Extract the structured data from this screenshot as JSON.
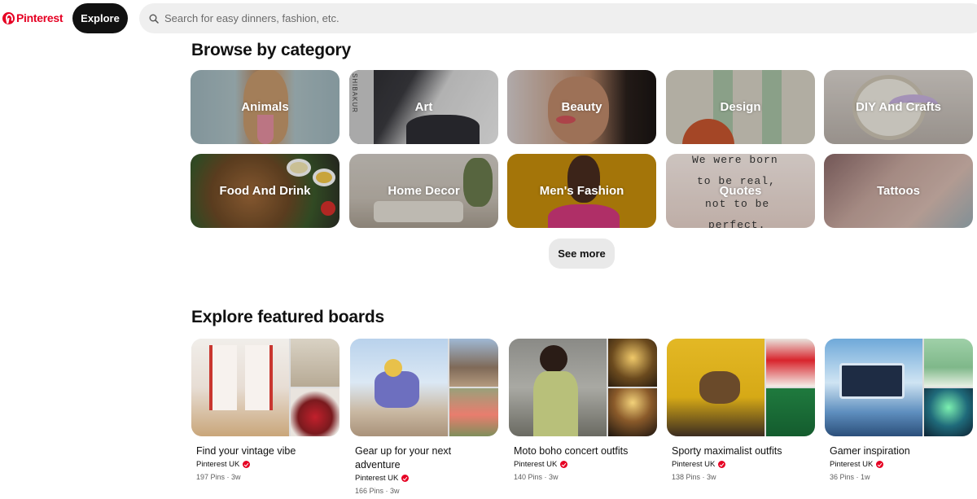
{
  "header": {
    "logo_text": "Pinterest",
    "explore_label": "Explore",
    "search_placeholder": "Search for easy dinners, fashion, etc.",
    "search_value": ""
  },
  "browse": {
    "title": "Browse by category",
    "categories": [
      {
        "label": "Animals"
      },
      {
        "label": "Art"
      },
      {
        "label": "Beauty"
      },
      {
        "label": "Design"
      },
      {
        "label": "DIY And Crafts"
      },
      {
        "label": "Food And Drink"
      },
      {
        "label": "Home Decor"
      },
      {
        "label": "Men's Fashion"
      },
      {
        "label": "Quotes"
      },
      {
        "label": "Tattoos"
      }
    ],
    "see_more_label": "See more",
    "quotes_image_text": [
      "We were born",
      "to be real,",
      "not to be",
      "perfect."
    ],
    "art_image_text": "SHIBAKUR"
  },
  "featured": {
    "title": "Explore featured boards",
    "boards": [
      {
        "title": "Find your vintage vibe",
        "owner": "Pinterest UK",
        "meta": "197 Pins · 3w"
      },
      {
        "title": "Gear up for your next adventure",
        "owner": "Pinterest UK",
        "meta": "166 Pins · 3w"
      },
      {
        "title": "Moto boho concert outfits",
        "owner": "Pinterest UK",
        "meta": "140 Pins · 3w"
      },
      {
        "title": "Sporty maximalist outfits",
        "owner": "Pinterest UK",
        "meta": "138 Pins · 3w"
      },
      {
        "title": "Gamer inspiration",
        "owner": "Pinterest UK",
        "meta": "36 Pins · 1w"
      }
    ]
  },
  "colors": {
    "brand": "#e60023",
    "explore_bg": "#111111",
    "search_bg": "#efefef",
    "see_more_bg": "#e9e9e9"
  },
  "icons": [
    "pinterest-logo-icon",
    "search-icon",
    "verified-icon"
  ]
}
